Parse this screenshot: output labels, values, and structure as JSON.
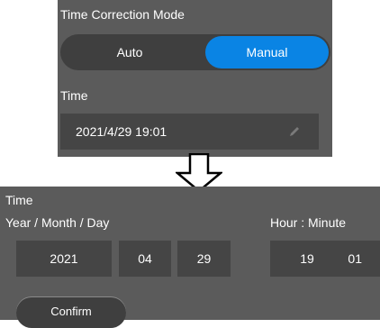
{
  "top": {
    "mode_label": "Time Correction Mode",
    "mode_options": [
      "Auto",
      "Manual"
    ],
    "selected_mode": "Manual",
    "time_label": "Time",
    "time_value": "2021/4/29 19:01",
    "edit_icon": "pencil-icon"
  },
  "bottom": {
    "time_label": "Time",
    "date_label": "Year / Month / Day",
    "clock_label": "Hour : Minute",
    "year": "2021",
    "month": "04",
    "day": "29",
    "hour": "19",
    "minute": "01",
    "confirm_label": "Confirm"
  },
  "colors": {
    "panel": "#5b5b5b",
    "field": "#454545",
    "toggle_track": "#3f3f3f",
    "accent": "#0a84e4"
  },
  "transition_icon": "down-arrow-icon"
}
